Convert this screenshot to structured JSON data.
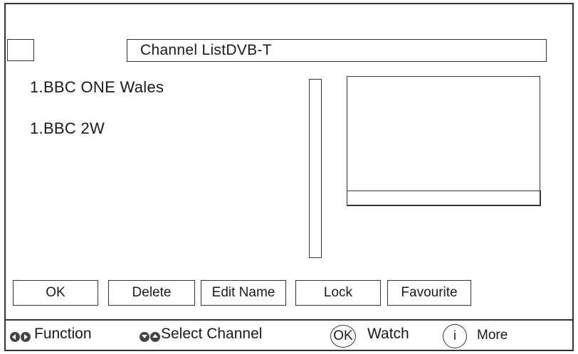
{
  "title": "Channel ListDVB-T",
  "channels": [
    "1.BBC ONE Wales",
    "1.BBC 2W"
  ],
  "buttons": {
    "ok": "OK",
    "delete": "Delete",
    "edit_name": "Edit Name",
    "lock": "Lock",
    "favourite": "Favourite"
  },
  "footer": {
    "function_label": "Function",
    "select_label": "Select Channel",
    "ok_key": "OK",
    "watch_label": "Watch",
    "info_key": "i",
    "more_label": "More",
    "icons": [
      "left-right-arrows-icon",
      "up-down-arrows-icon",
      "ok-key-icon",
      "info-key-icon"
    ]
  }
}
